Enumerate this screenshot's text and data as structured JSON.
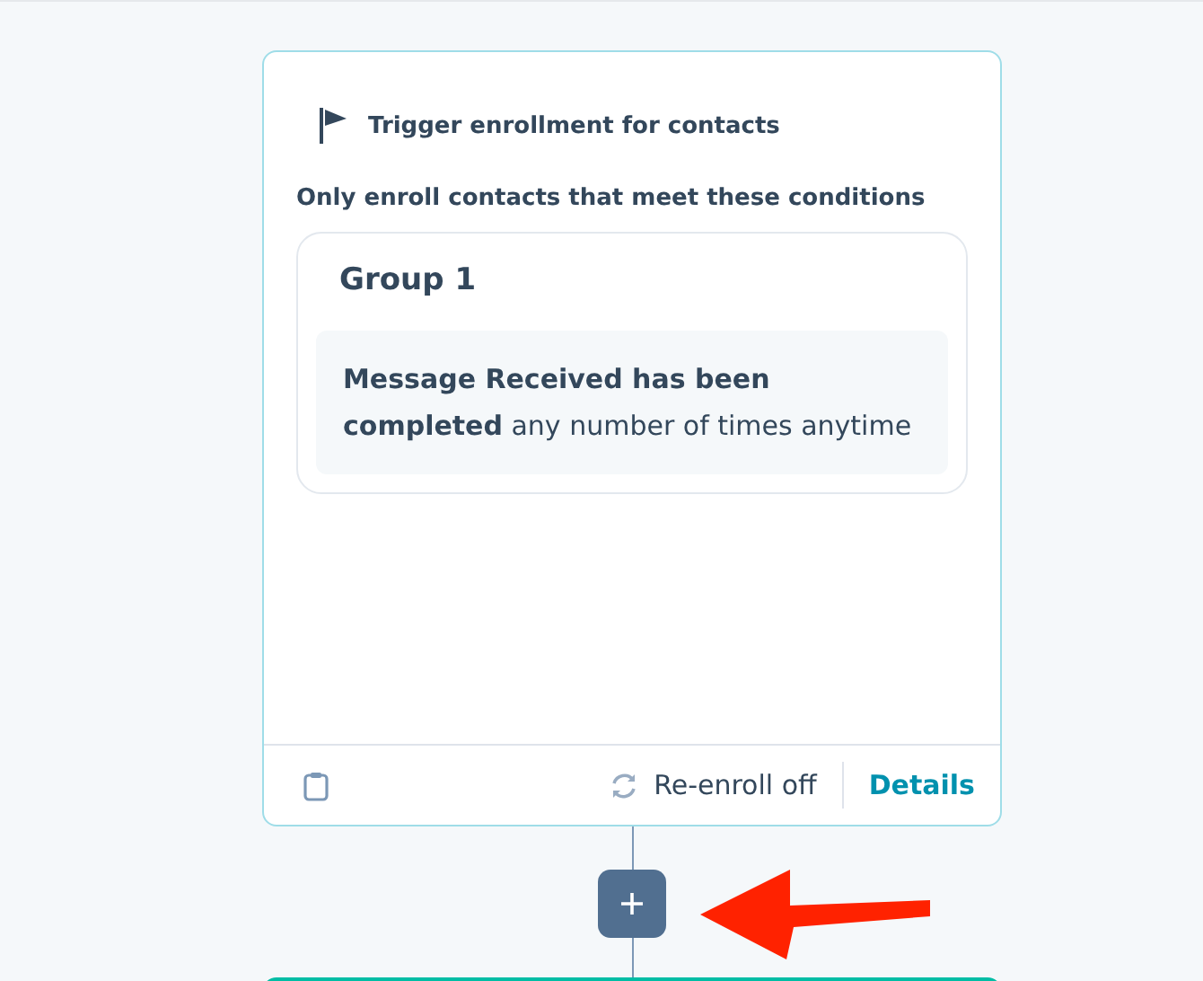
{
  "trigger": {
    "title": "Trigger enrollment for contacts",
    "subtitle": "Only enroll contacts that meet these conditions",
    "groups": [
      {
        "title": "Group 1",
        "conditions": [
          "**Message Received has been completed** any number of times anytime"
        ]
      }
    ],
    "footer": {
      "reenroll": "Re-enroll off",
      "details": "Details"
    }
  },
  "add_step": {
    "annotated": true
  }
}
